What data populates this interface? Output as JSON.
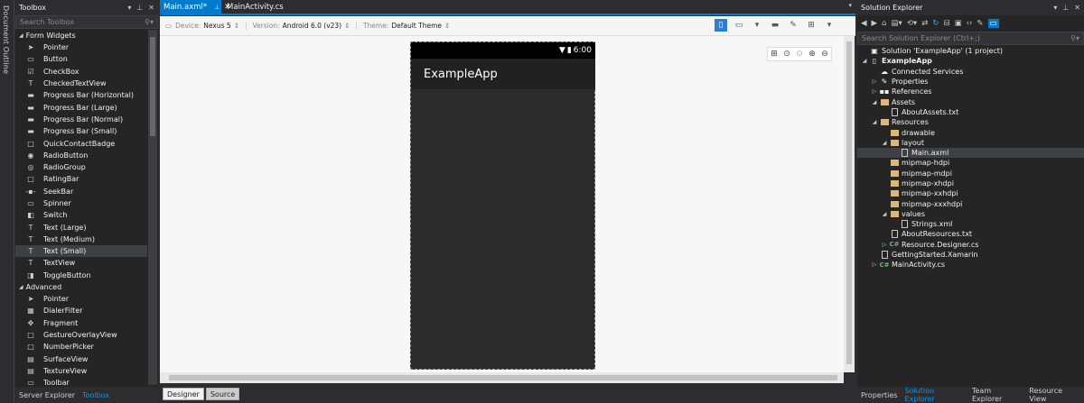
{
  "document_outline": {
    "label": "Document Outline"
  },
  "toolbox": {
    "title": "Toolbox",
    "search_placeholder": "Search Toolbox",
    "groups": [
      {
        "name": "Form Widgets",
        "items": [
          {
            "label": "Pointer",
            "icon": "pointer-icon",
            "glyph": "➤"
          },
          {
            "label": "Button",
            "icon": "button-icon",
            "glyph": "▭"
          },
          {
            "label": "CheckBox",
            "icon": "checkbox-icon",
            "glyph": "☑"
          },
          {
            "label": "CheckedTextView",
            "icon": "text-icon",
            "glyph": "T"
          },
          {
            "label": "Progress Bar (Horizontal)",
            "icon": "progress-bar-icon",
            "glyph": "▬"
          },
          {
            "label": "Progress Bar (Large)",
            "icon": "progress-bar-icon",
            "glyph": "▬"
          },
          {
            "label": "Progress Bar (Normal)",
            "icon": "progress-bar-icon",
            "glyph": "▬"
          },
          {
            "label": "Progress Bar (Small)",
            "icon": "progress-bar-icon",
            "glyph": "▬"
          },
          {
            "label": "QuickContactBadge",
            "icon": "badge-icon",
            "glyph": "□"
          },
          {
            "label": "RadioButton",
            "icon": "radio-icon",
            "glyph": "◉"
          },
          {
            "label": "RadioGroup",
            "icon": "radio-group-icon",
            "glyph": "◎"
          },
          {
            "label": "RatingBar",
            "icon": "rating-icon",
            "glyph": "□"
          },
          {
            "label": "SeekBar",
            "icon": "seekbar-icon",
            "glyph": "-▪-"
          },
          {
            "label": "Spinner",
            "icon": "spinner-icon",
            "glyph": "▭"
          },
          {
            "label": "Switch",
            "icon": "switch-icon",
            "glyph": "◧"
          },
          {
            "label": "Text (Large)",
            "icon": "text-icon",
            "glyph": "T"
          },
          {
            "label": "Text (Medium)",
            "icon": "text-icon",
            "glyph": "T"
          },
          {
            "label": "Text (Small)",
            "icon": "text-icon",
            "glyph": "T",
            "selected": true
          },
          {
            "label": "TextView",
            "icon": "text-icon",
            "glyph": "T"
          },
          {
            "label": "ToggleButton",
            "icon": "toggle-icon",
            "glyph": "◨"
          }
        ]
      },
      {
        "name": "Advanced",
        "items": [
          {
            "label": "Pointer",
            "icon": "pointer-icon",
            "glyph": "➤"
          },
          {
            "label": "DialerFilter",
            "icon": "dialer-icon",
            "glyph": "▦"
          },
          {
            "label": "Fragment",
            "icon": "fragment-icon",
            "glyph": "✥"
          },
          {
            "label": "GestureOverlayView",
            "icon": "view-icon",
            "glyph": "□"
          },
          {
            "label": "NumberPicker",
            "icon": "picker-icon",
            "glyph": "□"
          },
          {
            "label": "SurfaceView",
            "icon": "view-icon",
            "glyph": "▤"
          },
          {
            "label": "TextureView",
            "icon": "view-icon",
            "glyph": "▤"
          },
          {
            "label": "Toolbar",
            "icon": "toolbar-icon",
            "glyph": "▭"
          }
        ]
      }
    ],
    "bottom_tabs": [
      {
        "label": "Server Explorer",
        "active": false
      },
      {
        "label": "Toolbox",
        "active": true
      }
    ]
  },
  "editor": {
    "tabs": [
      {
        "label": "Main.axml*",
        "active": true
      },
      {
        "label": "MainActivity.cs",
        "active": false
      }
    ],
    "toolbar": {
      "device_label": "Device:",
      "device_value": "Nexus 5",
      "version_label": "Version:",
      "version_value": "Android 6.0 (v23)",
      "theme_label": "Theme:",
      "theme_value": "Default Theme"
    },
    "phone": {
      "time": "6:00",
      "app_title": "ExampleApp"
    },
    "view_tabs": [
      {
        "label": "Designer",
        "active": true
      },
      {
        "label": "Source",
        "active": false
      }
    ]
  },
  "solution_explorer": {
    "title": "Solution Explorer",
    "search_placeholder": "Search Solution Explorer (Ctrl+;)",
    "tree": [
      {
        "label": "Solution 'ExampleApp' (1 project)",
        "depth": 0,
        "arrow": "",
        "icon": "solution-icon",
        "glyph": "▣"
      },
      {
        "label": "ExampleApp",
        "depth": 0,
        "arrow": "◢",
        "icon": "project-icon",
        "glyph": "▯",
        "bold": true
      },
      {
        "label": "Connected Services",
        "depth": 1,
        "arrow": "",
        "icon": "connected-services-icon",
        "glyph": "☁"
      },
      {
        "label": "Properties",
        "depth": 1,
        "arrow": "▷",
        "icon": "wrench-icon",
        "glyph": "✎"
      },
      {
        "label": "References",
        "depth": 1,
        "arrow": "▷",
        "icon": "references-icon",
        "glyph": "▪▪"
      },
      {
        "label": "Assets",
        "depth": 1,
        "arrow": "◢",
        "icon": "folder-icon",
        "glyph": "folder"
      },
      {
        "label": "AboutAssets.txt",
        "depth": 2,
        "arrow": "",
        "icon": "file-icon",
        "glyph": "file"
      },
      {
        "label": "Resources",
        "depth": 1,
        "arrow": "◢",
        "icon": "folder-icon",
        "glyph": "folder"
      },
      {
        "label": "drawable",
        "depth": 2,
        "arrow": "",
        "icon": "folder-icon",
        "glyph": "folder"
      },
      {
        "label": "layout",
        "depth": 2,
        "arrow": "◢",
        "icon": "folder-icon",
        "glyph": "folder"
      },
      {
        "label": "Main.axml",
        "depth": 3,
        "arrow": "",
        "icon": "file-icon",
        "glyph": "file",
        "selected": true
      },
      {
        "label": "mipmap-hdpi",
        "depth": 2,
        "arrow": "",
        "icon": "folder-icon",
        "glyph": "folder"
      },
      {
        "label": "mipmap-mdpi",
        "depth": 2,
        "arrow": "",
        "icon": "folder-icon",
        "glyph": "folder"
      },
      {
        "label": "mipmap-xhdpi",
        "depth": 2,
        "arrow": "",
        "icon": "folder-icon",
        "glyph": "folder"
      },
      {
        "label": "mipmap-xxhdpi",
        "depth": 2,
        "arrow": "",
        "icon": "folder-icon",
        "glyph": "folder"
      },
      {
        "label": "mipmap-xxxhdpi",
        "depth": 2,
        "arrow": "",
        "icon": "folder-icon",
        "glyph": "folder"
      },
      {
        "label": "values",
        "depth": 2,
        "arrow": "◢",
        "icon": "folder-icon",
        "glyph": "folder"
      },
      {
        "label": "Strings.xml",
        "depth": 3,
        "arrow": "",
        "icon": "file-icon",
        "glyph": "file"
      },
      {
        "label": "AboutResources.txt",
        "depth": 2,
        "arrow": "",
        "icon": "file-icon",
        "glyph": "file"
      },
      {
        "label": "Resource.Designer.cs",
        "depth": 2,
        "arrow": "▷",
        "icon": "csharp-icon",
        "glyph": "C#"
      },
      {
        "label": "GettingStarted.Xamarin",
        "depth": 1,
        "arrow": "",
        "icon": "file-icon",
        "glyph": "file"
      },
      {
        "label": "MainActivity.cs",
        "depth": 1,
        "arrow": "▷",
        "icon": "csharp-icon",
        "glyph": "C#"
      }
    ],
    "bottom_tabs": [
      {
        "label": "Properties",
        "active": false
      },
      {
        "label": "Solution Explorer",
        "active": true
      },
      {
        "label": "Team Explorer",
        "active": false
      },
      {
        "label": "Resource View",
        "active": false
      }
    ]
  },
  "colors": {
    "accent": "#007acc",
    "link": "#0097fb",
    "folder": "#dcb67a"
  }
}
